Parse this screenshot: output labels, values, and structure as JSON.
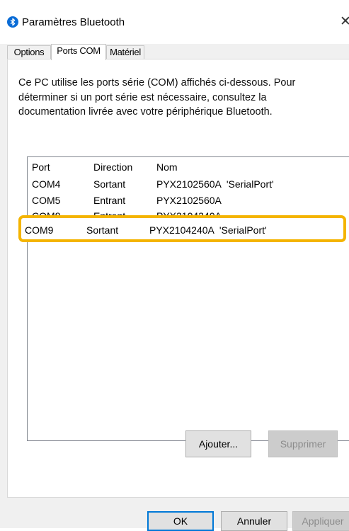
{
  "window": {
    "title": "Paramètres Bluetooth",
    "close_glyph": "✕",
    "icon": "bluetooth-icon"
  },
  "tabs": [
    {
      "label": "Options",
      "active": false
    },
    {
      "label": "Ports COM",
      "active": true
    },
    {
      "label": "Matériel",
      "active": false
    }
  ],
  "description": "Ce PC utilise les ports série (COM) affichés ci-dessous. Pour déterminer si un port série est nécessaire, consultez la documentation livrée avec votre périphérique Bluetooth.",
  "ports_list": {
    "columns": [
      "Port",
      "Direction",
      "Nom"
    ],
    "rows": [
      {
        "port": "COM4",
        "direction": "Sortant",
        "nom": "PYX2102560A  'SerialPort'"
      },
      {
        "port": "COM5",
        "direction": "Entrant",
        "nom": "PYX2102560A"
      },
      {
        "port": "COM8",
        "direction": "Entrant",
        "nom": "PYX2104240A"
      },
      {
        "port": "COM9",
        "direction": "Sortant",
        "nom": "PYX2104240A  'SerialPort'",
        "highlighted": true
      }
    ]
  },
  "buttons": {
    "add": "Ajouter...",
    "remove": "Supprimer",
    "ok": "OK",
    "cancel": "Annuler",
    "apply": "Appliquer"
  },
  "colors": {
    "highlight": "#f4b400",
    "bluetooth": "#0a6cd6",
    "default_button_border": "#0078d7",
    "disabled_text": "#8c8c8c"
  }
}
